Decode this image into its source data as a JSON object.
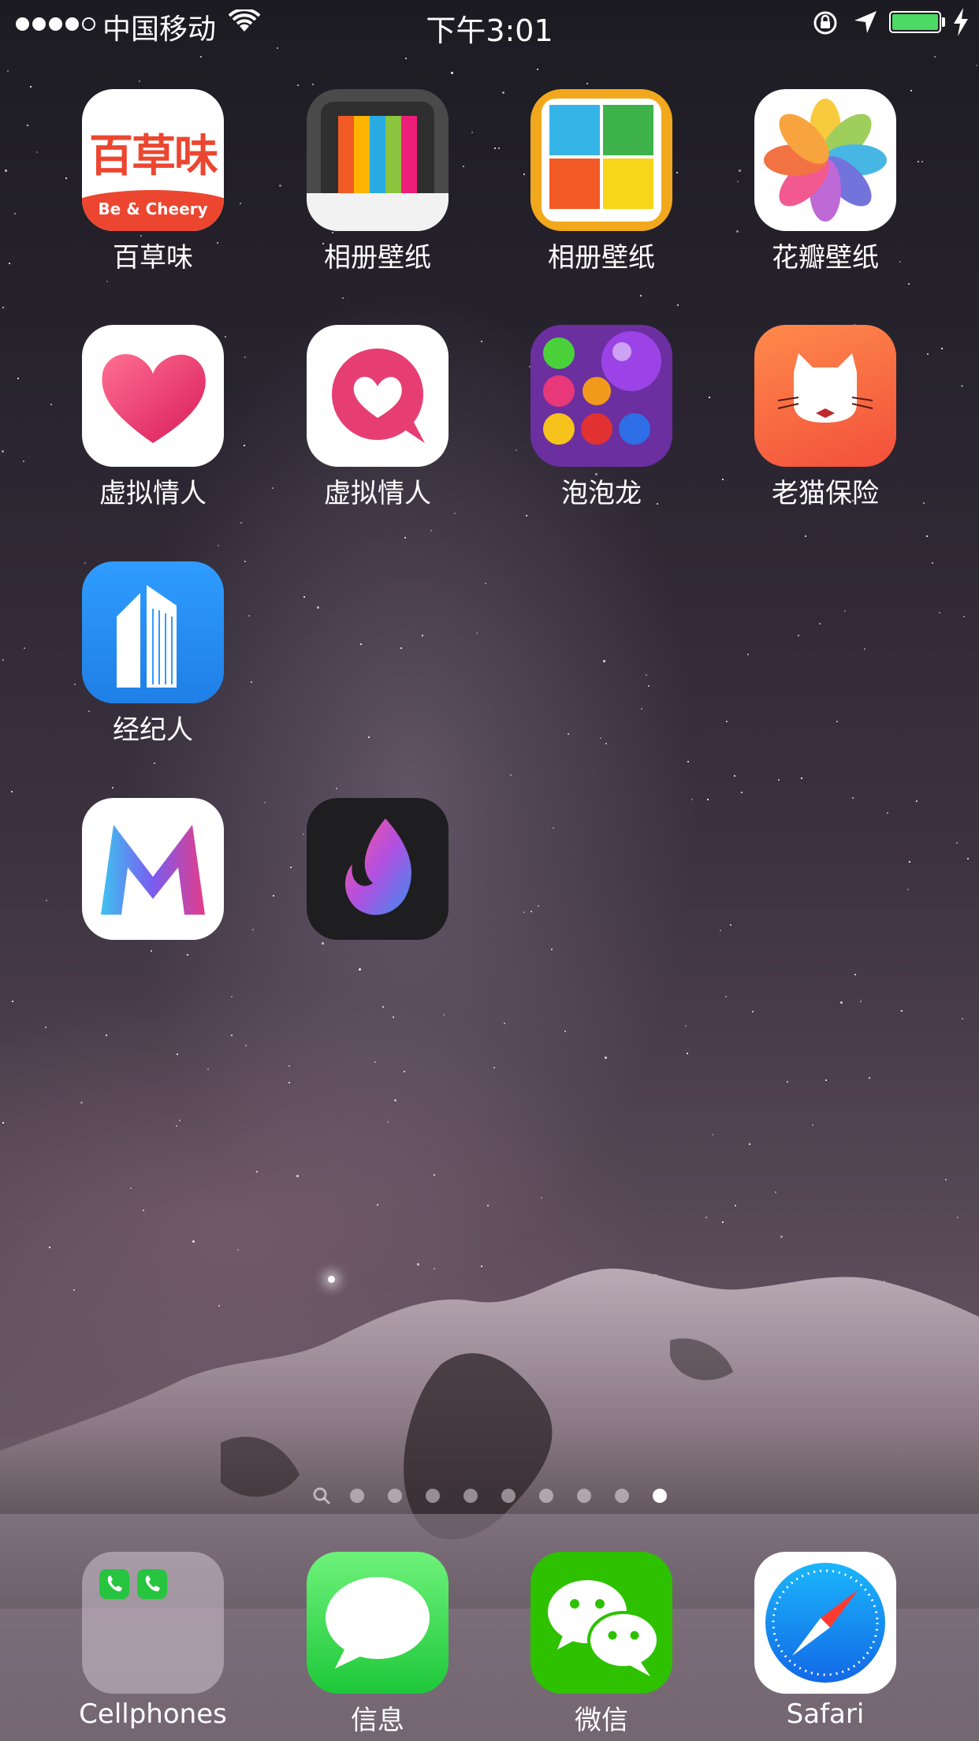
{
  "status_bar": {
    "carrier": "中国移动",
    "time": "下午3:01",
    "battery_level": 1.0,
    "signal_bars_filled": 4,
    "signal_bars_total": 5
  },
  "apps": [
    {
      "label": "百草味",
      "brand_text": "百草味",
      "brand_sub": "Be & Cheery",
      "icon": "baicaowei-icon"
    },
    {
      "label": "相册壁纸",
      "icon": "album-wallpaper-stripes-icon"
    },
    {
      "label": "相册壁纸",
      "icon": "album-wallpaper-tiles-icon"
    },
    {
      "label": "花瓣壁纸",
      "icon": "petal-flower-icon"
    },
    {
      "label": "虚拟情人",
      "icon": "heart-icon"
    },
    {
      "label": "虚拟情人",
      "icon": "heart-bubble-icon"
    },
    {
      "label": "泡泡龙",
      "icon": "bubble-game-icon"
    },
    {
      "label": "老猫保险",
      "icon": "cat-icon"
    },
    {
      "label": "经纪人",
      "icon": "building-icon"
    },
    {
      "label": "",
      "icon": "m-logo-icon"
    },
    {
      "label": "",
      "icon": "flame-logo-icon"
    }
  ],
  "page_indicator": {
    "total_pages": 9,
    "current_page": 9,
    "has_search_page": true
  },
  "dock": [
    {
      "label": "Cellphones",
      "icon": "folder-icon"
    },
    {
      "label": "信息",
      "icon": "messages-icon"
    },
    {
      "label": "微信",
      "icon": "wechat-icon"
    },
    {
      "label": "Safari",
      "icon": "safari-compass-icon"
    }
  ],
  "colors": {
    "battery": "#4cd964",
    "messages_green": "#3fd84a",
    "wechat_green": "#2dc100",
    "safari_blue": "#1c8ff0"
  }
}
